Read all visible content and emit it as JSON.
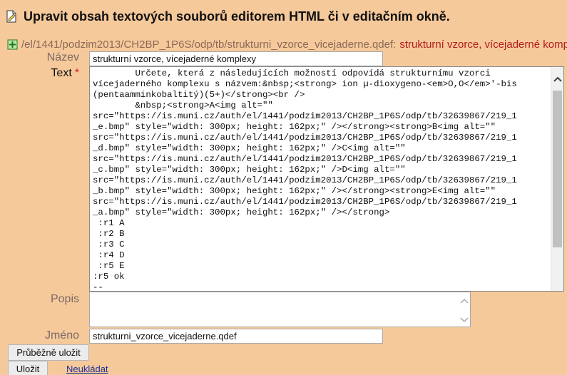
{
  "header": {
    "title": "Upravit obsah textových souborů editorem HTML či v editačním okně."
  },
  "pathline": {
    "path": "/el/1441/podzim2013/CH2BP_1P6S/odp/tb/strukturni_vzorce_vicejaderne.qdef:",
    "name": "strukturní vzorce, vícejaderné komplexy"
  },
  "form": {
    "nazev_label": "Název",
    "nazev_value": "strukturní vzorce, vícejaderné komplexy",
    "text_label": "Text",
    "text_required": "*",
    "text_lines": [
      "        Určete, která z následujících možností odpovídá strukturnímu vzorci",
      "vícejaderného komplexu s názvem:&nbsp;<strong> ion µ-dioxygeno-<em>O,O</em>′-bis",
      "(pentaamminkobaltitý)(5+)</strong><br />",
      "        &nbsp;<strong>A<img alt=\"\"",
      "src=\"https://is.muni.cz/auth/el/1441/podzim2013/CH2BP_1P6S/odp/tb/32639867/219_1",
      "_e.bmp\" style=\"width: 300px; height: 162px;\" /></strong><strong>B<img alt=\"\"",
      "src=\"https://is.muni.cz/auth/el/1441/podzim2013/CH2BP_1P6S/odp/tb/32639867/219_1",
      "_d.bmp\" style=\"width: 300px; height: 162px;\" />C<img alt=\"\"",
      "src=\"https://is.muni.cz/auth/el/1441/podzim2013/CH2BP_1P6S/odp/tb/32639867/219_1",
      "_c.bmp\" style=\"width: 300px; height: 162px;\" />D<img alt=\"\"",
      "src=\"https://is.muni.cz/auth/el/1441/podzim2013/CH2BP_1P6S/odp/tb/32639867/219_1",
      "_b.bmp\" style=\"width: 300px; height: 162px;\" /></strong><strong>E<img alt=\"\"",
      "src=\"https://is.muni.cz/auth/el/1441/podzim2013/CH2BP_1P6S/odp/tb/32639867/219_1",
      "_a.bmp\" style=\"width: 300px; height: 162px;\" /></strong>",
      " :r1 A",
      " :r2 B",
      " :r3 C",
      " :r4 D",
      " :r5 E",
      ":r5 ok",
      "--"
    ],
    "popis_label": "Popis",
    "jmeno_label": "Jméno",
    "jmeno_value": "strukturni_vzorce_vicejaderne.qdef"
  },
  "actions": {
    "save_progress": "Průběžně uložit",
    "save": "Uložit",
    "discard": "Neukládat"
  },
  "icons": {
    "doc": "document-edit-icon",
    "path": "green-plus-icon",
    "scroll_up": "scroll-up-arrow-icon",
    "scroll_down": "scroll-down-arrow-icon"
  }
}
